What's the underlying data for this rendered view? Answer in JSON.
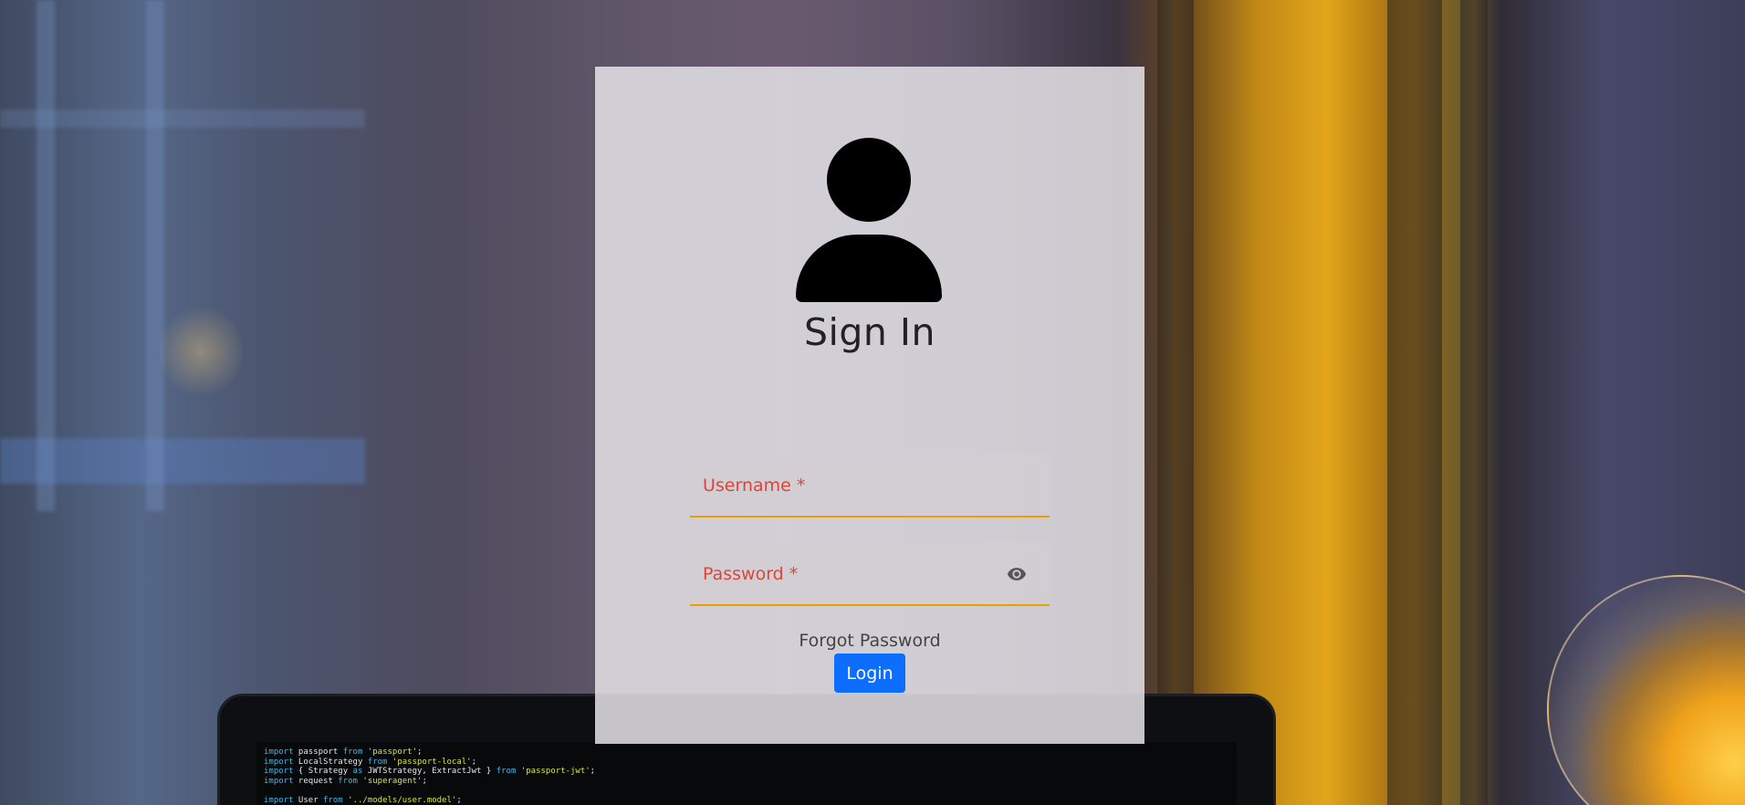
{
  "page": {
    "title": "Sign In"
  },
  "form": {
    "username_label": "Username *",
    "username_value": "",
    "password_label": "Password *",
    "password_value": "",
    "forgot_password": "Forgot Password",
    "login_label": "Login"
  },
  "icons": {
    "avatar": "user-avatar-icon",
    "password_toggle": "eye-icon"
  },
  "colors": {
    "accent_underline": "#e6a100",
    "label_error": "#d9473a",
    "login_button": "#0d6efd"
  },
  "background_code": [
    "import passport from 'passport';",
    "import LocalStrategy from 'passport-local';",
    "import { Strategy as JWTStrategy, ExtractJwt } from 'passport-jwt';",
    "import request from 'superagent';",
    "",
    "import User from '../models/user.model';"
  ]
}
